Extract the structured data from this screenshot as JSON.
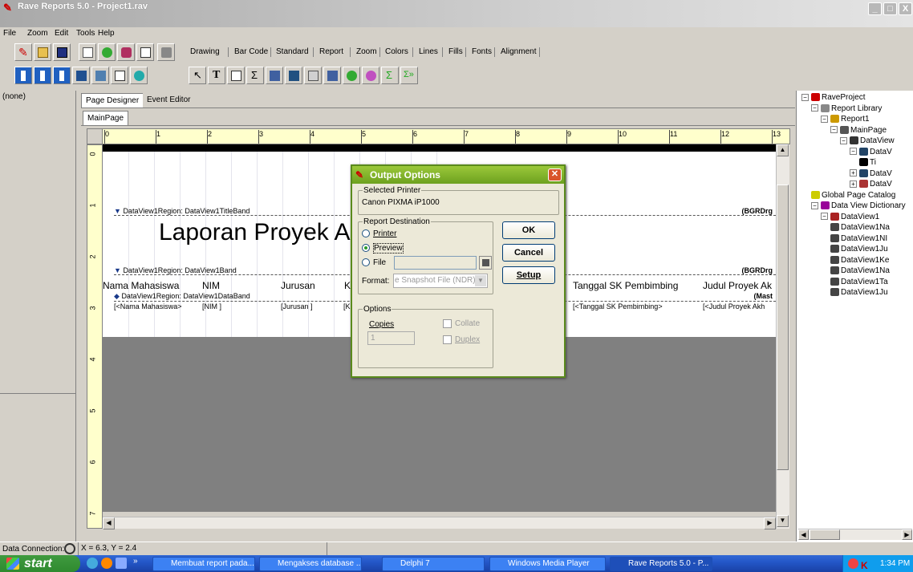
{
  "window": {
    "title": "Rave Reports 5.0 - Project1.rav",
    "min": "_",
    "max": "□",
    "close": "X"
  },
  "menu": [
    "File",
    "Zoom",
    "Edit",
    "Tools",
    "Help"
  ],
  "component_tabs": [
    "Drawing",
    "Bar Code",
    "Standard",
    "Report",
    "Zoom",
    "Colors",
    "Lines",
    "Fills",
    "Fonts",
    "Alignment"
  ],
  "left_panel": {
    "selection": "(none)"
  },
  "designer": {
    "tabs": [
      "Page Designer",
      "Event Editor"
    ],
    "page_tab": "MainPage",
    "ruler_h": [
      "0",
      "1",
      "2",
      "3",
      "4",
      "5",
      "6",
      "7",
      "8",
      "9",
      "10",
      "11",
      "12",
      "13"
    ],
    "ruler_v": [
      "0",
      "1",
      "2",
      "3",
      "4",
      "5",
      "6",
      "7"
    ],
    "bands": {
      "title_band": "DataView1Region: DataView1TitleBand",
      "title_flags": "(BGRDrg",
      "report_title": "Laporan Proyek A",
      "band": "DataView1Region: DataView1Band",
      "band_flags": "(BGRDrg",
      "data_band": "DataView1Region: DataView1DataBand",
      "data_flags": "(Mast"
    },
    "headers": [
      "Nama Mahasiswa",
      "NIM",
      "Jurusan",
      "K",
      "Tanggal SK Pembimbing",
      "Judul Proyek Ak"
    ],
    "fields": [
      "[<Nama Mahasiswa>",
      "[NIM ]",
      "[Jurusan  ]",
      "[K",
      "[<Tanggal SK Pembimbing>",
      "[<Judul Proyek Akh"
    ]
  },
  "dialog": {
    "title": "Output Options",
    "selected_printer_label": "Selected Printer",
    "printer": "Canon PIXMA iP1000",
    "destination_label": "Report Destination",
    "dest_printer": "Printer",
    "dest_preview": "Preview",
    "dest_file": "File",
    "format_label": "Format:",
    "format_value": "e Snapshot File (NDR)",
    "ok": "OK",
    "cancel": "Cancel",
    "setup": "Setup",
    "options_label": "Options",
    "copies_label": "Copies",
    "copies_value": "1",
    "collate": "Collate",
    "duplex": "Duplex"
  },
  "tree": [
    {
      "label": "RaveProject",
      "indent": 0,
      "pm": "−",
      "icon": "rave-icon"
    },
    {
      "label": "Report Library",
      "indent": 1,
      "pm": "−",
      "icon": "library-icon"
    },
    {
      "label": "Report1",
      "indent": 2,
      "pm": "−",
      "icon": "report-icon"
    },
    {
      "label": "MainPage",
      "indent": 3,
      "pm": "−",
      "icon": "page-icon"
    },
    {
      "label": "DataView",
      "indent": 4,
      "pm": "−",
      "icon": "region-icon"
    },
    {
      "label": "DataV",
      "indent": 5,
      "pm": "−",
      "icon": "band-icon"
    },
    {
      "label": "Ti",
      "indent": 6,
      "pm": "",
      "icon": "text-icon"
    },
    {
      "label": "DataV",
      "indent": 5,
      "pm": "+",
      "icon": "band-icon"
    },
    {
      "label": "DataV",
      "indent": 5,
      "pm": "+",
      "icon": "databand-icon"
    },
    {
      "label": "Global Page Catalog",
      "indent": 1,
      "pm": "",
      "icon": "catalog-icon"
    },
    {
      "label": "Data View Dictionary",
      "indent": 1,
      "pm": "−",
      "icon": "dictionary-icon"
    },
    {
      "label": "DataView1",
      "indent": 2,
      "pm": "−",
      "icon": "dataview-icon"
    },
    {
      "label": "DataView1Na",
      "indent": 3,
      "pm": "",
      "icon": "field-icon"
    },
    {
      "label": "DataView1NI",
      "indent": 3,
      "pm": "",
      "icon": "field-icon"
    },
    {
      "label": "DataView1Ju",
      "indent": 3,
      "pm": "",
      "icon": "field-icon"
    },
    {
      "label": "DataView1Ke",
      "indent": 3,
      "pm": "",
      "icon": "field-icon"
    },
    {
      "label": "DataView1Na",
      "indent": 3,
      "pm": "",
      "icon": "field-icon"
    },
    {
      "label": "DataView1Ta",
      "indent": 3,
      "pm": "",
      "icon": "field-icon"
    },
    {
      "label": "DataView1Ju",
      "indent": 3,
      "pm": "",
      "icon": "field-icon"
    }
  ],
  "status": {
    "label": "Data Connection:",
    "coords": "X = 6.3, Y = 2.4"
  },
  "taskbar": {
    "start": "start",
    "tasks": [
      "Membuat report pada...",
      "Mengakses database ...",
      "Delphi 7",
      "Windows Media Player",
      "Rave Reports 5.0 - P..."
    ],
    "clock": "1:34 PM"
  }
}
